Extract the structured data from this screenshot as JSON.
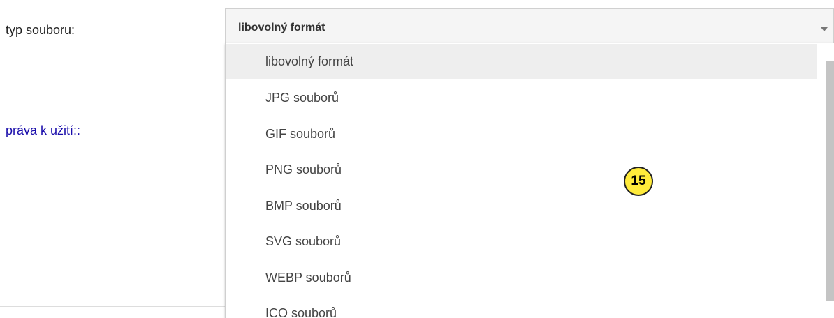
{
  "labels": {
    "file_type": "typ souboru:",
    "usage_rights": "práva k užití::"
  },
  "select": {
    "selected_value": "libovolný formát",
    "arrow_icon": "chevron-down-icon",
    "options": [
      "libovolný formát",
      "JPG souborů",
      "GIF souborů",
      "PNG souborů",
      "BMP souborů",
      "SVG souborů",
      "WEBP souborů",
      "ICO souborů"
    ]
  },
  "annotation": {
    "step_number": "15",
    "badge_color": "#ffeb3b"
  }
}
